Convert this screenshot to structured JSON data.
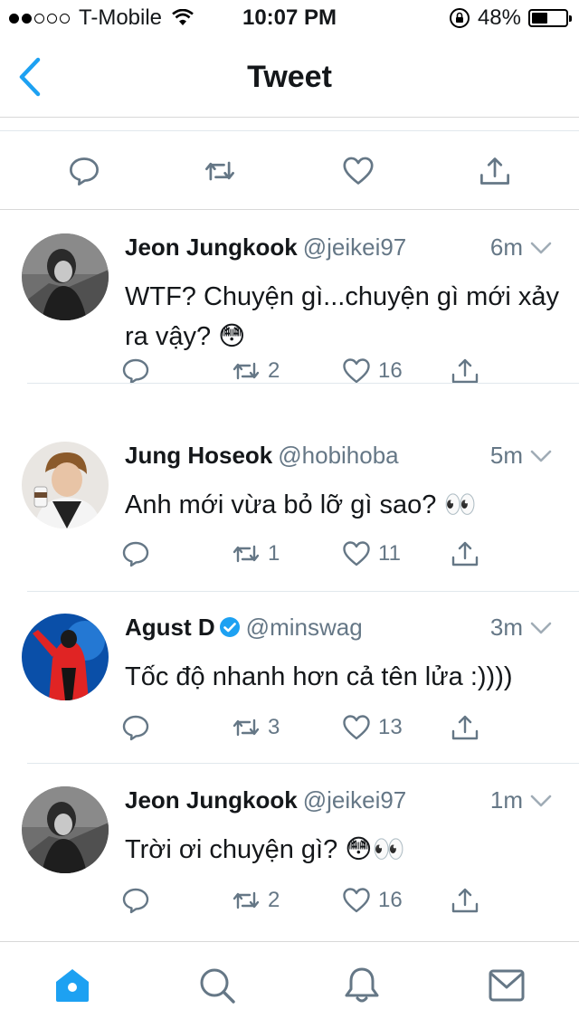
{
  "status_bar": {
    "carrier": "T-Mobile",
    "time": "10:07 PM",
    "battery": "48%",
    "battery_level": 0.48
  },
  "nav": {
    "title": "Tweet",
    "back_icon": "chevron-left-icon"
  },
  "colors": {
    "accent": "#1da1f2",
    "text": "#14171a",
    "secondary": "#657786",
    "divider": "#e1e8ed"
  },
  "top_actions": [
    "reply-icon",
    "retweet-icon",
    "like-icon",
    "share-icon"
  ],
  "tweets": [
    {
      "name": "Jeon Jungkook",
      "handle": "@jeikei97",
      "time": "6m",
      "text": "WTF? Chuyện gì...chuyện gì mới xảy ra vậy? 😳",
      "retweets": "2",
      "likes": "16",
      "verified": false
    },
    {
      "name": "Jung Hoseok",
      "handle": "@hobihoba",
      "time": "5m",
      "text": "Anh mới vừa bỏ lỡ gì sao? 👀",
      "retweets": "1",
      "likes": "11",
      "verified": false
    },
    {
      "name": "Agust D",
      "handle": "@minswag",
      "time": "3m",
      "text": "Tốc độ nhanh hơn cả tên lửa :))))",
      "retweets": "3",
      "likes": "13",
      "verified": true
    },
    {
      "name": "Jeon Jungkook",
      "handle": "@jeikei97",
      "time": "1m",
      "text": "Trời ơi chuyện gì? 😳👀",
      "retweets": "2",
      "likes": "16",
      "verified": false
    }
  ],
  "tab_bar": [
    "home-icon",
    "search-icon",
    "notifications-icon",
    "messages-icon"
  ]
}
